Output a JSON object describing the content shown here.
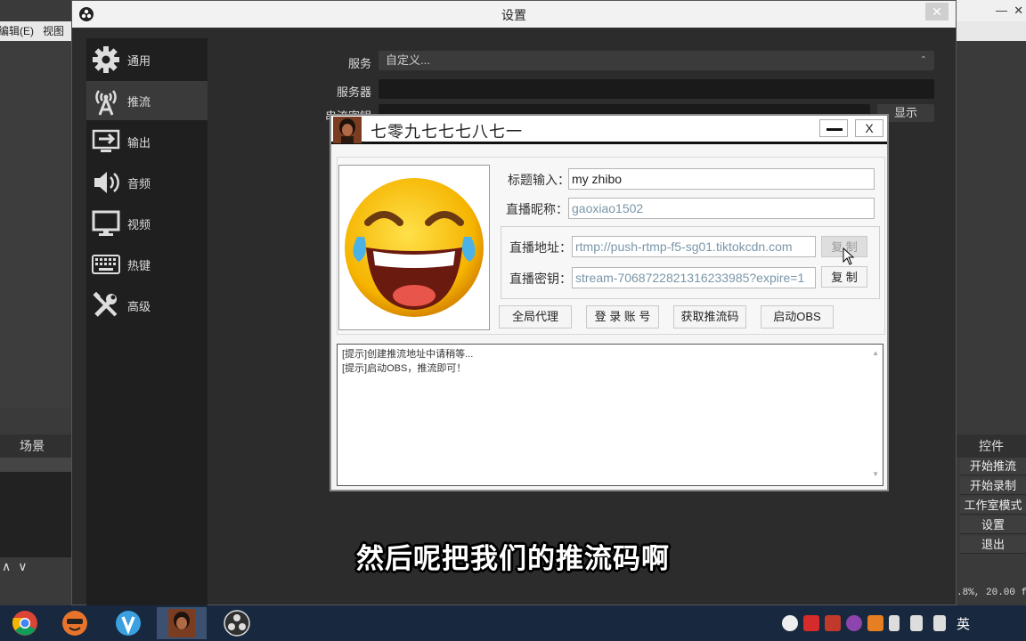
{
  "obs_left": {
    "menu": [
      "编辑(E)",
      "视图"
    ],
    "scenes_header": "场景",
    "scene_tools": [
      "∧",
      "∨"
    ]
  },
  "obs_right": {
    "controls_header": "控件",
    "controls": [
      "开始推流",
      "开始录制",
      "工作室模式",
      "设置",
      "退出"
    ],
    "status": ".8%, 20.00 fp"
  },
  "settings": {
    "title": "设置",
    "nav": [
      {
        "label": "通用",
        "icon": "gear-icon"
      },
      {
        "label": "推流",
        "icon": "antenna-icon"
      },
      {
        "label": "输出",
        "icon": "output-icon"
      },
      {
        "label": "音频",
        "icon": "speaker-icon"
      },
      {
        "label": "视频",
        "icon": "monitor-icon"
      },
      {
        "label": "热键",
        "icon": "keyboard-icon"
      },
      {
        "label": "高级",
        "icon": "tools-icon"
      }
    ],
    "service_label": "服务",
    "service_value": "自定义...",
    "server_label": "服务器",
    "stream_key_label": "串流密钥",
    "show_button": "显示"
  },
  "tool": {
    "title": "七零九七七七八七一",
    "fields": {
      "title_label": "标题输入：",
      "title_value": "my zhibo",
      "nickname_label": "直播昵称：",
      "nickname_value": "gaoxiao1502",
      "address_label": "直播地址：",
      "address_value": "rtmp://push-rtmp-f5-sg01.tiktokcdn.com",
      "key_label": "直播密钥：",
      "key_value": "stream-7068722821316233985?expire=1"
    },
    "copy_button_1": "复 制",
    "copy_button_2": "复 制",
    "buttons": [
      "全局代理",
      "登 录 账 号",
      "获取推流码",
      "启动OBS"
    ],
    "log": [
      "[提示]创建推流地址中请稍等...",
      "[提示]启动OBS，推流即可！"
    ]
  },
  "subtitle": "然后呢把我们的推流码啊",
  "taskbar": {
    "apps": [
      "chrome-icon",
      "game-icon",
      "v-app-icon",
      "avatar-app-icon",
      "obs-icon"
    ],
    "lang": "英"
  }
}
